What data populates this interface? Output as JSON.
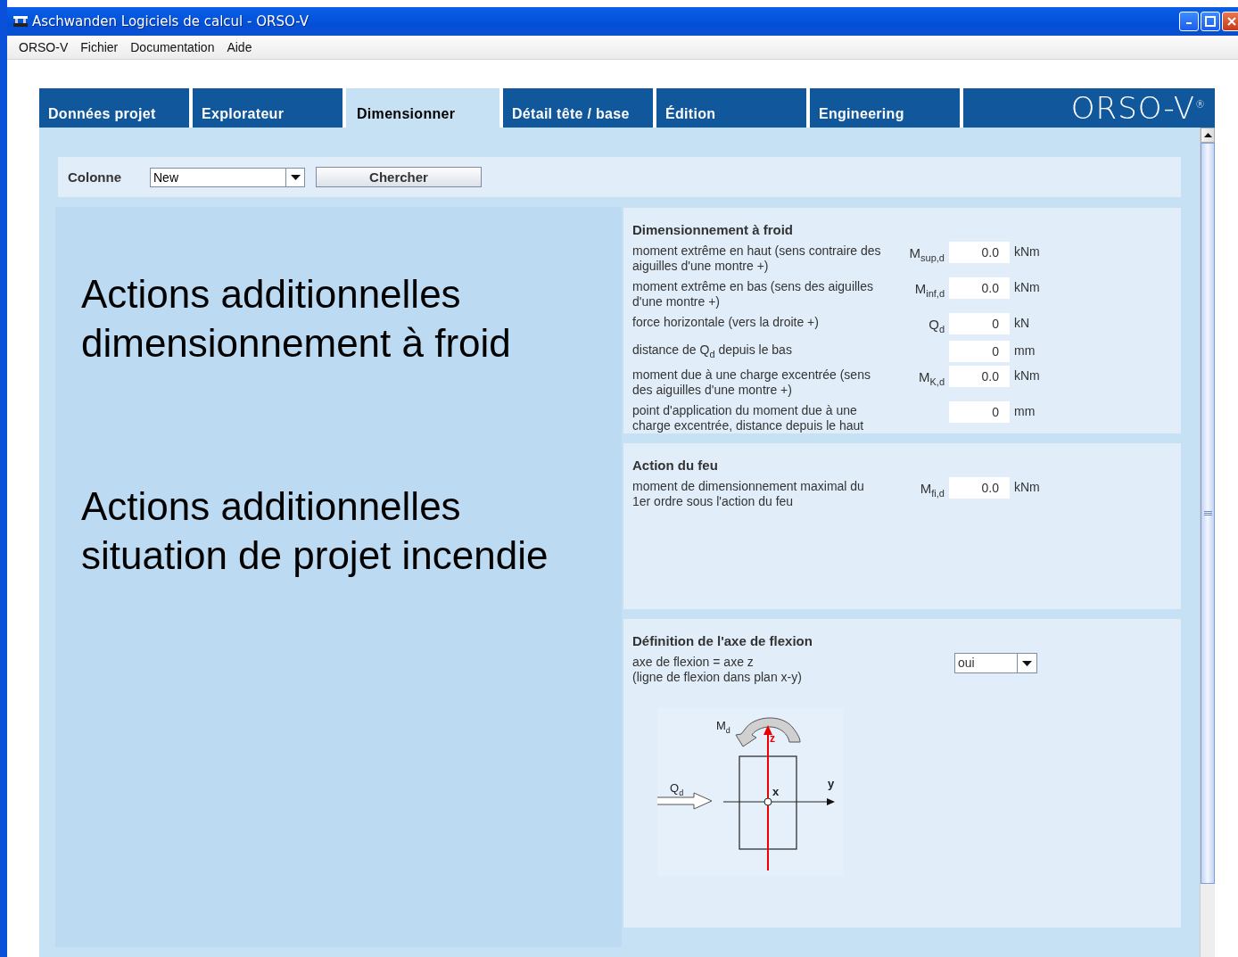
{
  "window": {
    "title": "Aschwanden Logiciels de calcul - ORSO-V"
  },
  "menu": [
    "ORSO-V",
    "Fichier",
    "Documentation",
    "Aide"
  ],
  "tabs": [
    {
      "label": "Données projet",
      "selected": false
    },
    {
      "label": "Explorateur",
      "selected": false
    },
    {
      "label": "Dimensionner",
      "selected": true
    },
    {
      "label": "Détail tête / base",
      "selected": false
    },
    {
      "label": "Édition",
      "selected": false
    },
    {
      "label": "Engineering",
      "selected": false
    }
  ],
  "logo": {
    "text": "ORSO-V",
    "mark": "®"
  },
  "search_bar": {
    "label": "Colonne",
    "value": "New",
    "button": "Chercher"
  },
  "headings": [
    "Actions additionnelles dimensionnement à froid",
    "Actions additionnelles situation de projet incendie"
  ],
  "sections": [
    {
      "title": "Dimensionnement à froid",
      "rows": [
        {
          "kind": "number",
          "label": "moment extrême en haut (sens contraire des aiguilles d'une montre +)",
          "symbol": "M$_{sup,d}$",
          "value": "0.0",
          "unit": "kNm"
        },
        {
          "kind": "number",
          "label": "moment extrême en bas (sens des aiguilles d'une montre +)",
          "symbol": "M$_{inf,d}$",
          "value": "0.0",
          "unit": "kNm"
        },
        {
          "kind": "number",
          "label": "force horizontale (vers la droite +)",
          "symbol": "Q$_{d}$",
          "value": "0",
          "unit": "kN"
        },
        {
          "kind": "number",
          "label": "distance de Q$_{d}$ depuis le bas",
          "value": "0",
          "unit": "mm"
        },
        {
          "kind": "number",
          "label": "moment due à une charge excentrée (sens des aiguilles d'une montre +)",
          "symbol": "M$_{K,d}$",
          "value": "0.0",
          "unit": "kNm"
        },
        {
          "kind": "number",
          "label": "point d'application du moment due à une charge excentrée, distance depuis le haut",
          "value": "0",
          "unit": "mm"
        }
      ]
    },
    {
      "title": "Action du feu",
      "rows": [
        {
          "kind": "number",
          "label": "moment de dimensionnement maximal du 1er ordre sous l'action du feu",
          "symbol": "M$_{fi,d}$",
          "value": "0.0",
          "unit": "kNm"
        }
      ]
    },
    {
      "title": "Définition de l'axe de flexion",
      "rows": [
        {
          "kind": "select",
          "label": "axe de flexion = axe z\n(ligne de flexion dans plan x-y)",
          "value": "oui"
        }
      ],
      "diagram": {
        "moment": "M$_{d}$",
        "force": "Q$_{d}$",
        "axis_z": "z",
        "axis_y": "y",
        "axis_x": "x"
      }
    }
  ]
}
